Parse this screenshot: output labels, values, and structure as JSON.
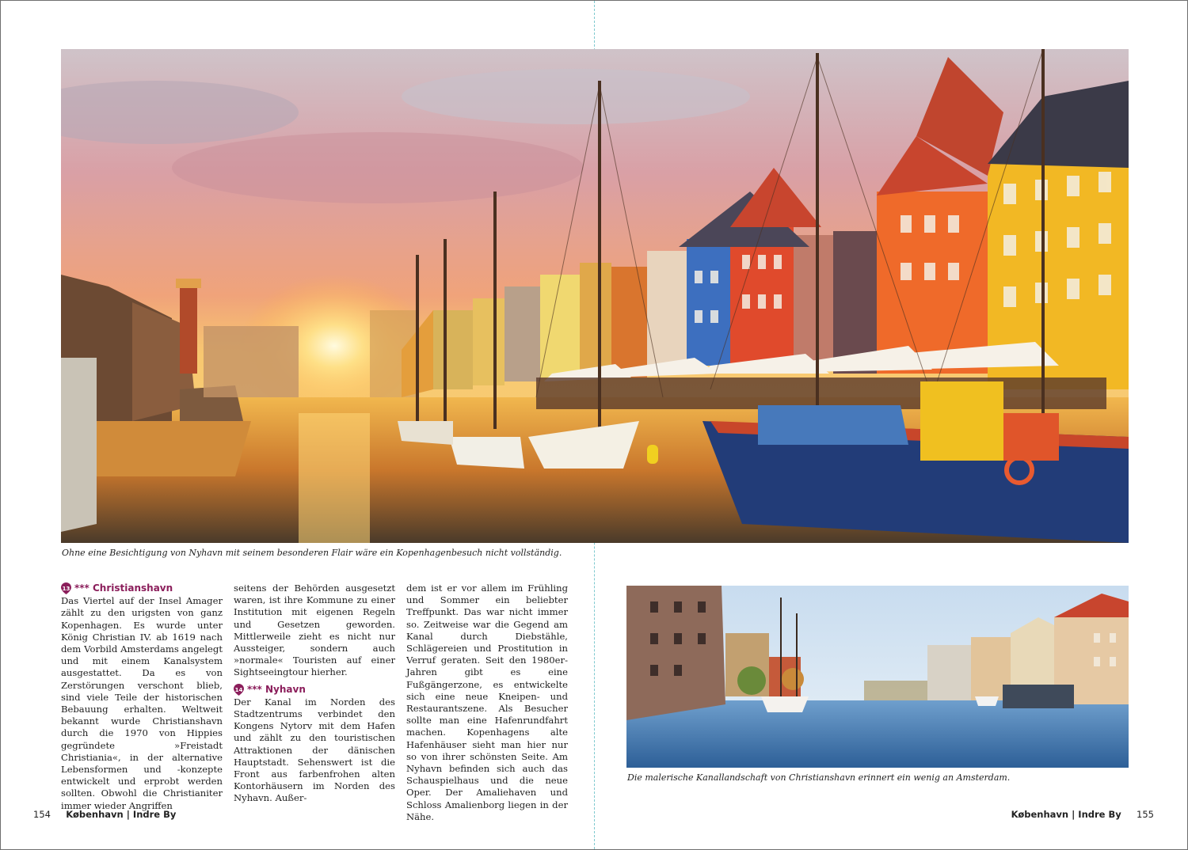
{
  "captions": {
    "main": "Ohne eine Besichtigung von Nyhavn mit seinem besonderen Flair wäre ein Kopenhagenbesuch nicht vollständig.",
    "small": "Die malerische Kanallandschaft von Christianshavn erinnert ein wenig an Amsterdam."
  },
  "sections": {
    "christianshavn": {
      "number": "13",
      "title": "*** Christianshavn"
    },
    "nyhavn": {
      "number": "14",
      "title": "*** Nyhavn"
    }
  },
  "text": {
    "col1": "Das Viertel auf der Insel Amager zählt zu den urigsten von ganz Kopenhagen. Es wurde unter König Christian IV. ab 1619 nach dem Vorbild Amsterdams angelegt und mit einem Kanalsystem ausgestattet. Da es von Zerstörungen verschont blieb, sind viele Teile der historischen Bebauung erhalten. Weltweit bekannt wurde Christianshavn durch die 1970 von Hippies gegründete »Freistadt Christiania«, in der alternative Lebensformen und -konzepte entwickelt und erprobt werden sollten. Obwohl die Christianiter immer wieder Angriffen",
    "col2a": "seitens der Behörden ausgesetzt waren, ist ihre Kommune zu einer Institution mit eigenen Regeln und Gesetzen geworden. Mittlerweile zieht es nicht nur Aussteiger, sondern auch »normale« Touristen auf einer Sightseeingtour hierher.",
    "col2b": "Der Kanal im Norden des Stadtzentrums verbindet den Kongens Nytorv mit dem Hafen und zählt zu den touristischen Attraktionen der dänischen Hauptstadt. Sehenswert ist die Front aus farbenfrohen alten Kontorhäusern im Norden des Nyhavn. Außer-",
    "col3": "dem ist er vor allem im Frühling und Sommer ein beliebter Treffpunkt. Das war nicht immer so. Zeitweise war die Gegend am Kanal durch Diebstähle, Schlägereien und Prostitution in Verruf geraten. Seit den 1980er-Jahren gibt es eine Fußgängerzone, es entwickelte sich eine neue Kneipen- und Restaurantszene. Als Besucher sollte man eine Hafenrundfahrt machen. Kopenhagens alte Hafenhäuser sieht man hier nur so von ihrer schönsten Seite. Am Nyhavn befinden sich auch das Schauspielhaus und die neue Oper. Der Amaliehaven und Schloss Amalienborg liegen in der Nähe."
  },
  "footer": {
    "left_page": "154",
    "left_label": "København | Indre By",
    "right_label": "København | Indre By",
    "right_page": "155"
  },
  "colors": {
    "accent": "#8b1e5b",
    "gutter": "#7fc9cf"
  }
}
